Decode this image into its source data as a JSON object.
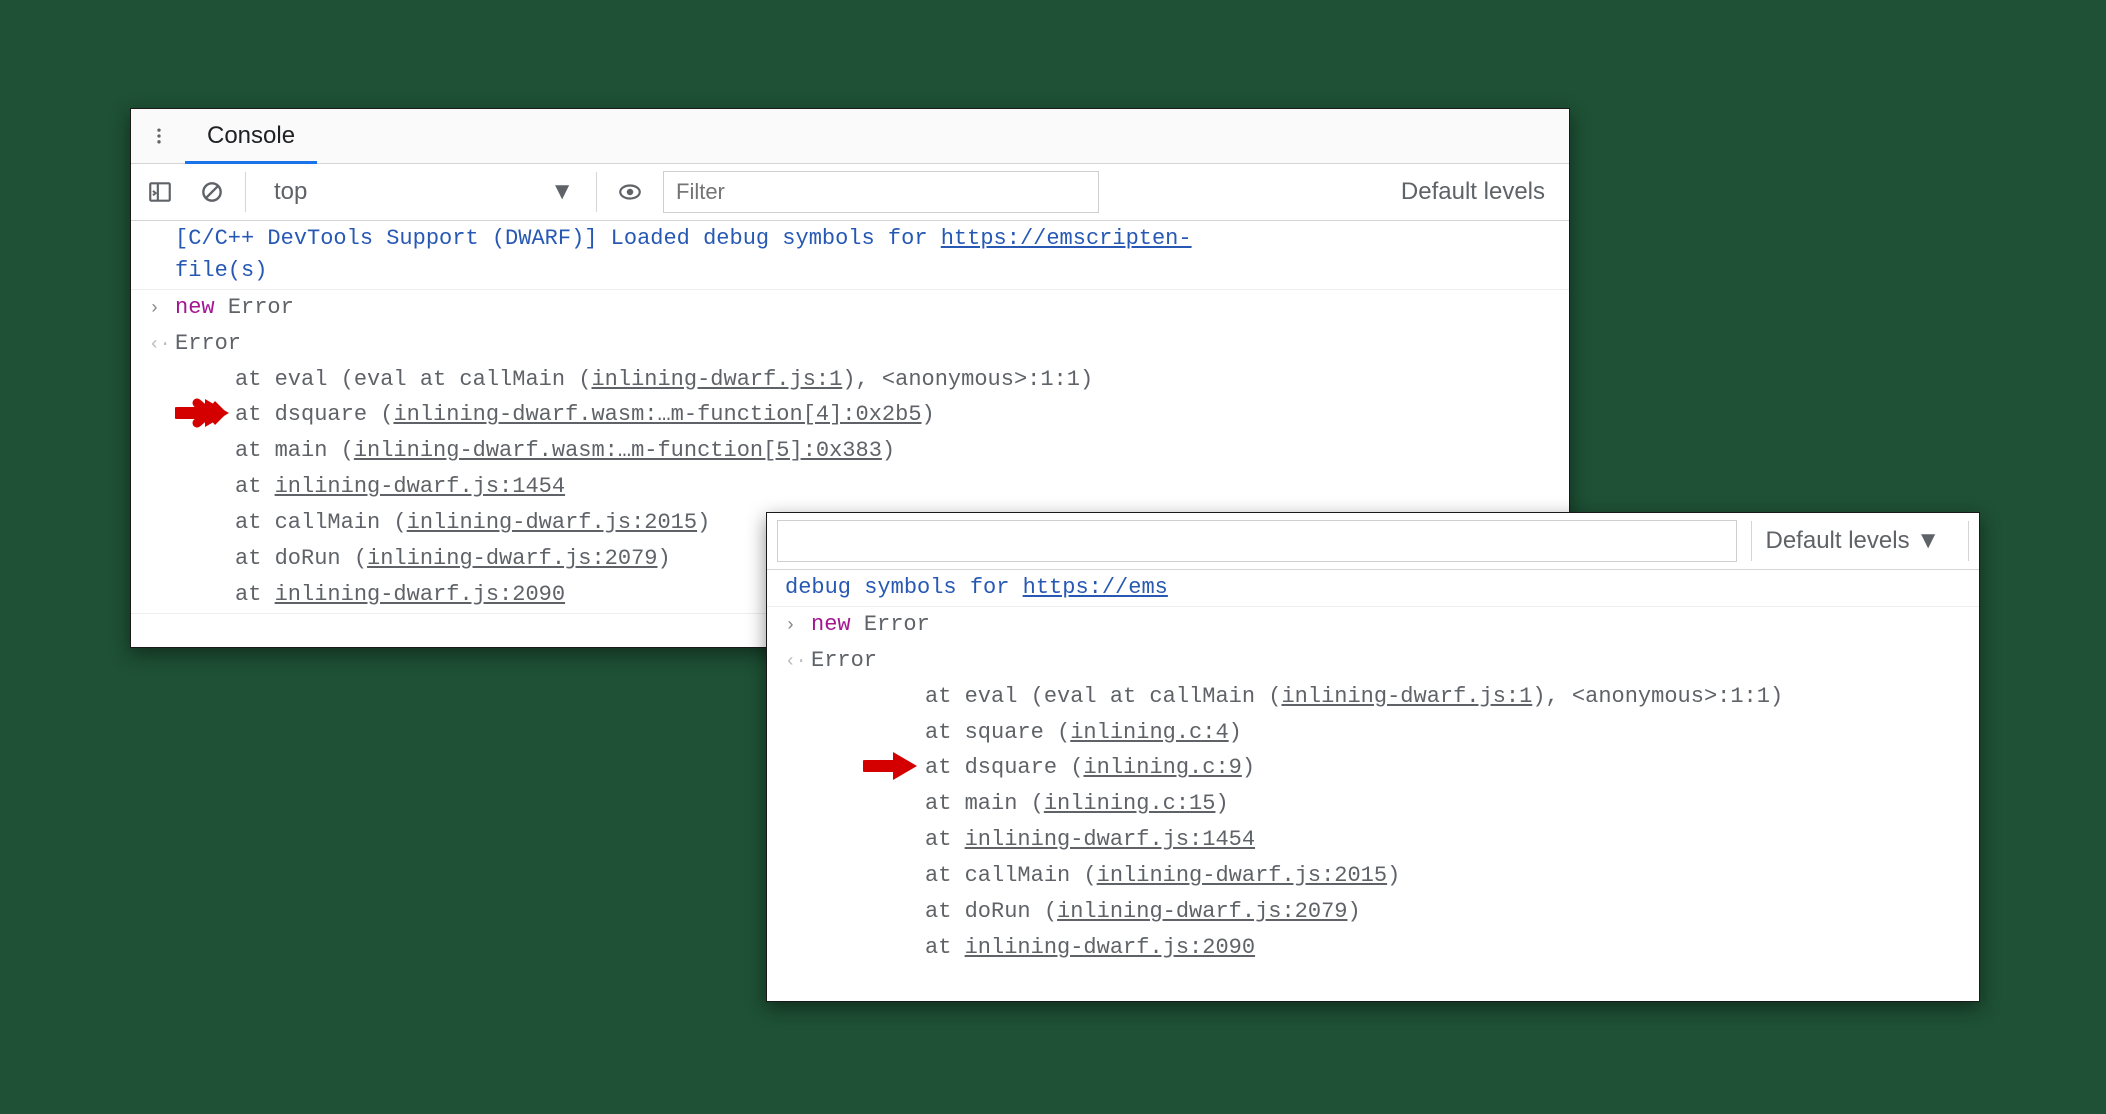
{
  "panelA": {
    "tab": "Console",
    "context": "top",
    "filterPlaceholder": "Filter",
    "levels": "Default levels",
    "info_prefix": "[C/C++ DevTools Support (DWARF)] Loaded debug symbols for ",
    "info_link": "https://emscripten-",
    "info_suffix": "file(s)",
    "new_kw": "new",
    "error_word": "Error",
    "trace": {
      "l1a": "at eval (eval at callMain (",
      "l1b": "inlining-dwarf.js:1",
      "l1c": "), <anonymous>:1:1)",
      "l2a": "at dsquare (",
      "l2b": "inlining-dwarf.wasm:…m-function[4]:0x2b5",
      "l2c": ")",
      "l3a": "at main (",
      "l3b": "inlining-dwarf.wasm:…m-function[5]:0x383",
      "l3c": ")",
      "l4a": "at ",
      "l4b": "inlining-dwarf.js:1454",
      "l5a": "at callMain (",
      "l5b": "inlining-dwarf.js:2015",
      "l5c": ")",
      "l6a": "at doRun (",
      "l6b": "inlining-dwarf.js:2079",
      "l6c": ")",
      "l7a": "at ",
      "l7b": "inlining-dwarf.js:2090"
    }
  },
  "panelB": {
    "levels": "Default levels ▼",
    "info_prefix": "debug symbols for ",
    "info_link": "https://ems",
    "new_kw": "new",
    "error_word": "Error",
    "trace": {
      "l1a": "at eval (eval at callMain (",
      "l1b": "inlining-dwarf.js:1",
      "l1c": "), <anonymous>:1:1)",
      "l2a": "at square (",
      "l2b": "inlining.c:4",
      "l2c": ")",
      "l3a": "at dsquare (",
      "l3b": "inlining.c:9",
      "l3c": ")",
      "l4a": "at main (",
      "l4b": "inlining.c:15",
      "l4c": ")",
      "l5a": "at ",
      "l5b": "inlining-dwarf.js:1454",
      "l6a": "at callMain (",
      "l6b": "inlining-dwarf.js:2015",
      "l6c": ")",
      "l7a": "at doRun (",
      "l7b": "inlining-dwarf.js:2079",
      "l7c": ")",
      "l8a": "at ",
      "l8b": "inlining-dwarf.js:2090"
    }
  }
}
